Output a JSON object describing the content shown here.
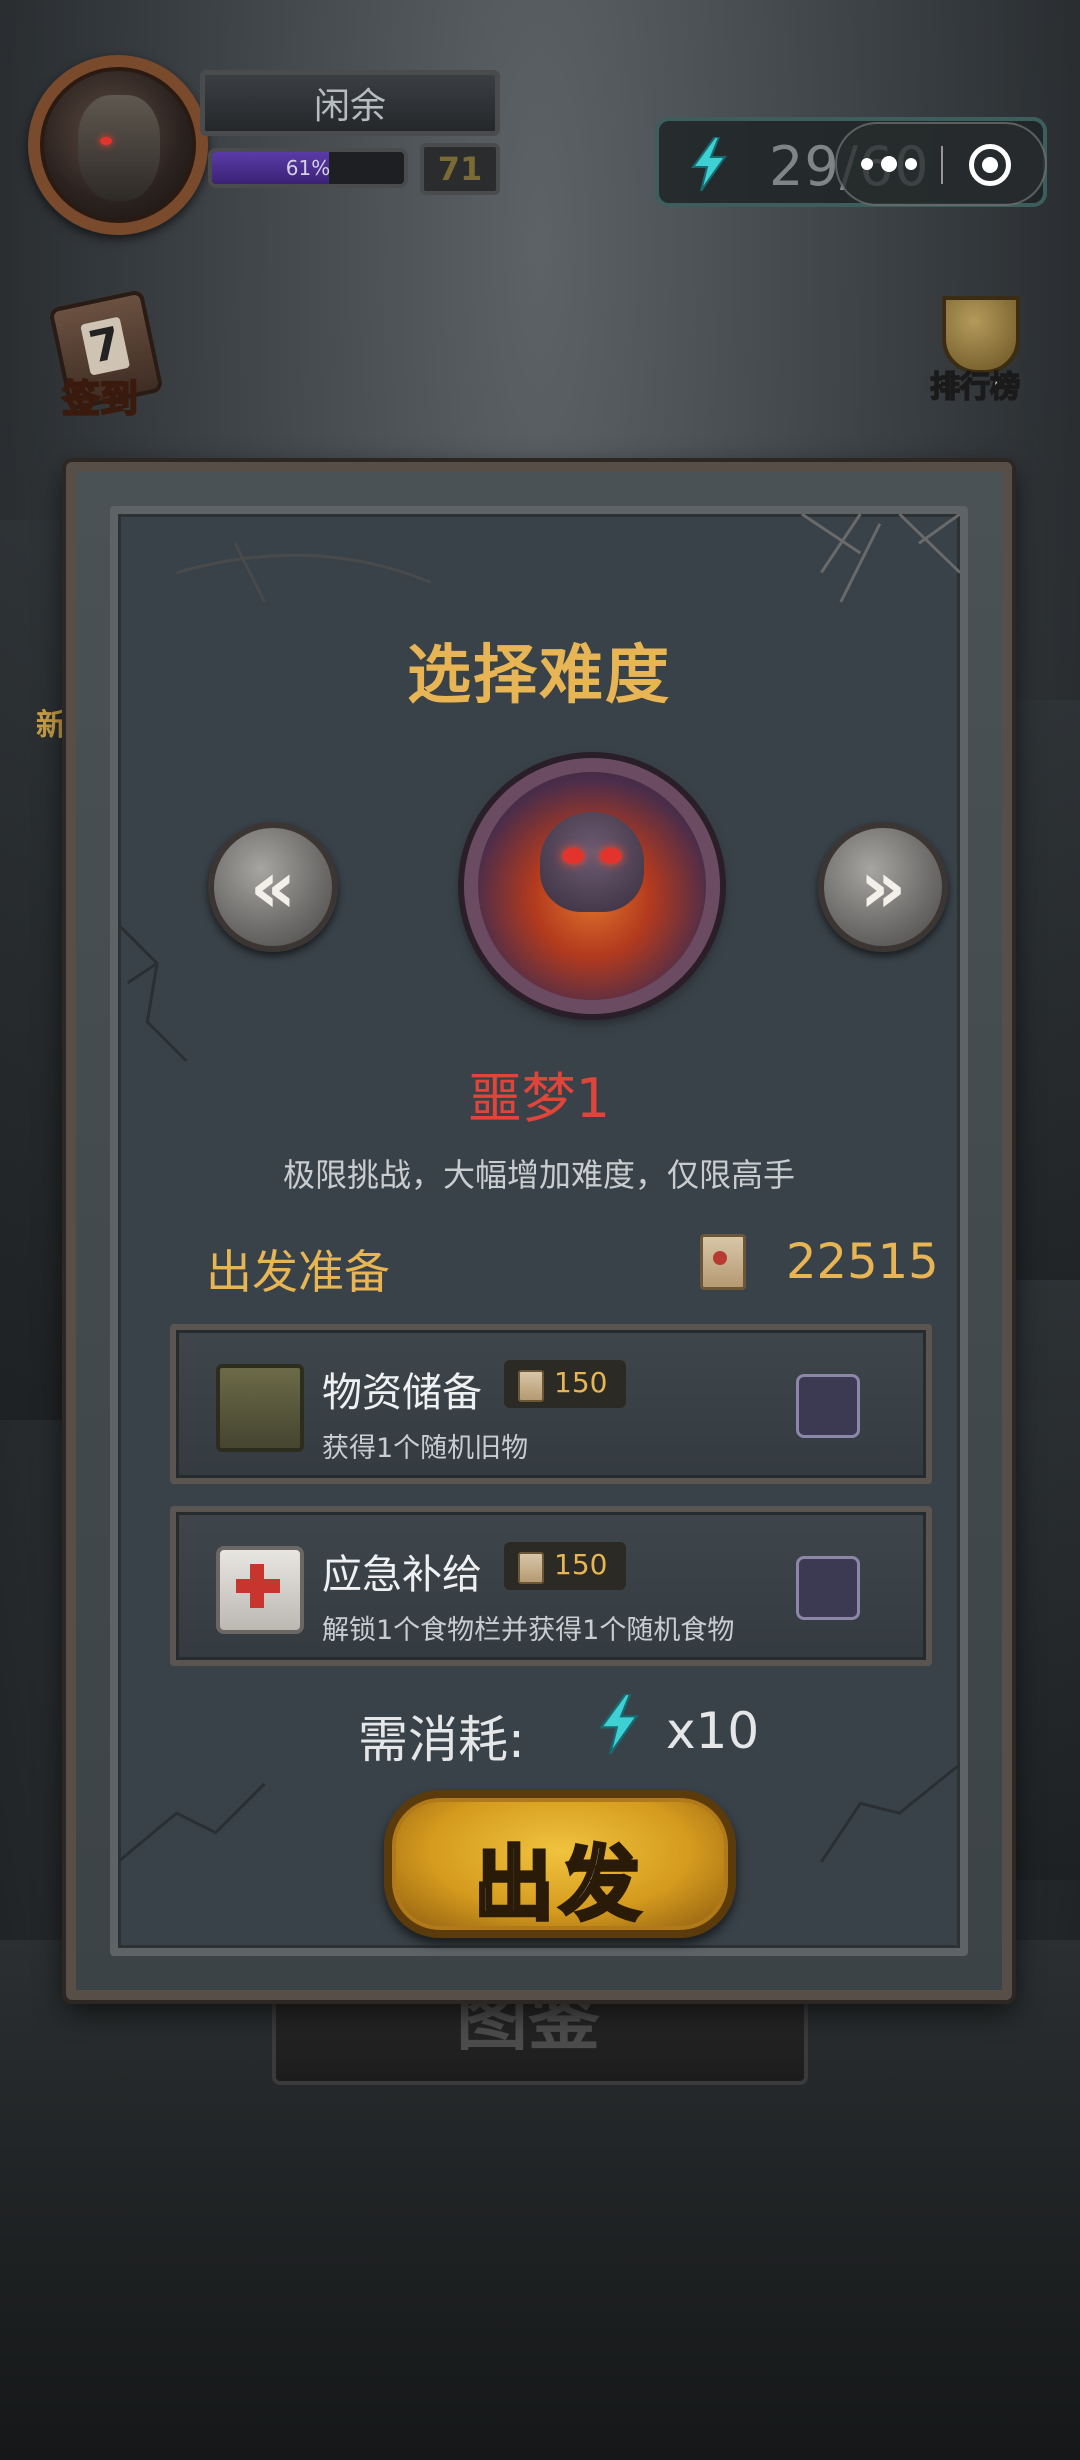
{
  "player": {
    "name": "闲余",
    "xp_percent_label": "61%",
    "xp_fraction": 0.61,
    "level": "71"
  },
  "energy": {
    "current_display": "29/60"
  },
  "side_buttons": {
    "checkin_day": "7",
    "checkin_label": "签到",
    "rank_label": "排行榜"
  },
  "background_partial_text": {
    "left_label": "新",
    "under_button": "图鉴"
  },
  "dialog": {
    "title": "选择难度",
    "difficulty_name": "噩梦1",
    "difficulty_desc": "极限挑战，大幅增加难度，仅限高手",
    "prep_title": "出发准备",
    "coins": "22515",
    "supplies": [
      {
        "name": "物资储备",
        "price": "150",
        "desc": "获得1个随机旧物",
        "icon": "crate-icon",
        "checked": false
      },
      {
        "name": "应急补给",
        "price": "150",
        "desc": "解锁1个食物栏并获得1个随机食物",
        "icon": "medkit-icon",
        "checked": false
      }
    ],
    "cost_label": "需消耗:",
    "cost_value": "x10",
    "go_label": "出发"
  },
  "colors": {
    "accent_gold": "#e8b555",
    "difficulty_red": "#e0443a",
    "energy_cyan": "#3fd0d4"
  }
}
